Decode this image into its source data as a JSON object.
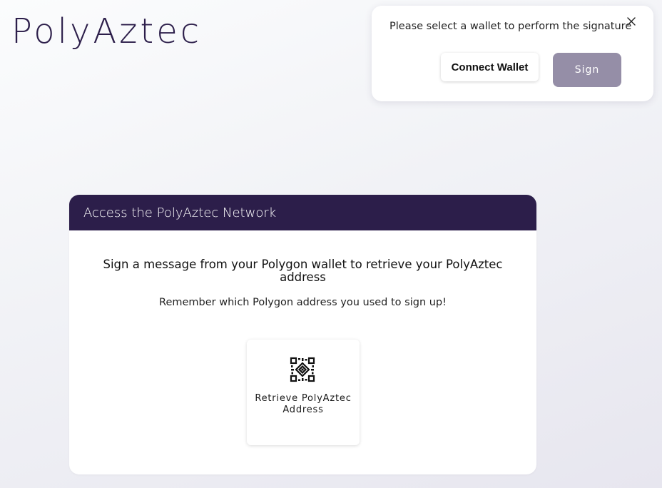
{
  "brand": {
    "name": "PolyAztec"
  },
  "wallet_popup": {
    "message": "Please select a wallet to perform the signature",
    "close_icon": "close-icon",
    "connect_label": "Connect Wallet",
    "sign_label": "Sign"
  },
  "access_card": {
    "header": "Access the PolyAztec Network",
    "title": "Sign a message from your Polygon wallet to retrieve your PolyAztec address",
    "subtitle": "Remember which Polygon address you used to sign up!",
    "action": {
      "icon": "qr-scan-icon",
      "label": "Retrieve PolyAztec Address"
    }
  },
  "colors": {
    "brand_primary": "#2c1e4a",
    "sign_button": "#958ea7",
    "card_background": "#ffffff"
  }
}
